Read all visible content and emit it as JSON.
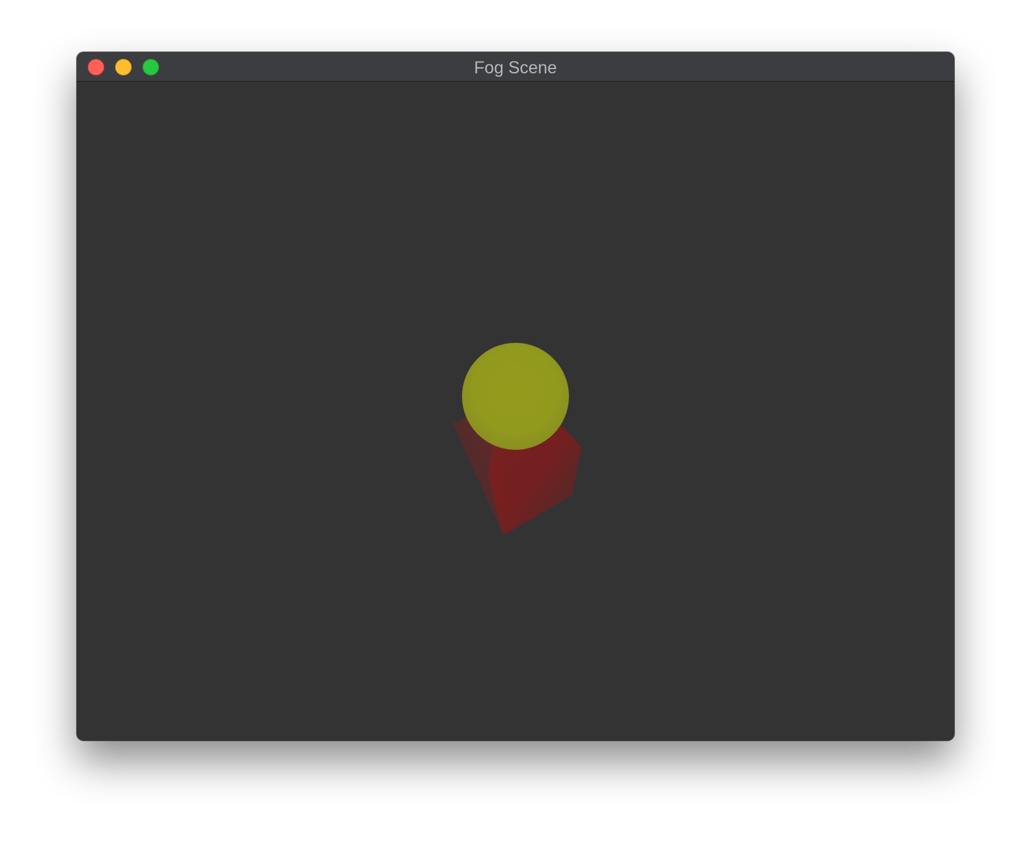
{
  "window": {
    "title": "Fog Scene",
    "controls": {
      "close_color": "#fe5f57",
      "minimize_color": "#febc2e",
      "zoom_color": "#28c840"
    }
  },
  "scene": {
    "background_color": "#333333",
    "objects": [
      {
        "name": "sphere",
        "color": "#9a9a1c"
      },
      {
        "name": "cube",
        "color": "#7a1e1e"
      }
    ]
  }
}
